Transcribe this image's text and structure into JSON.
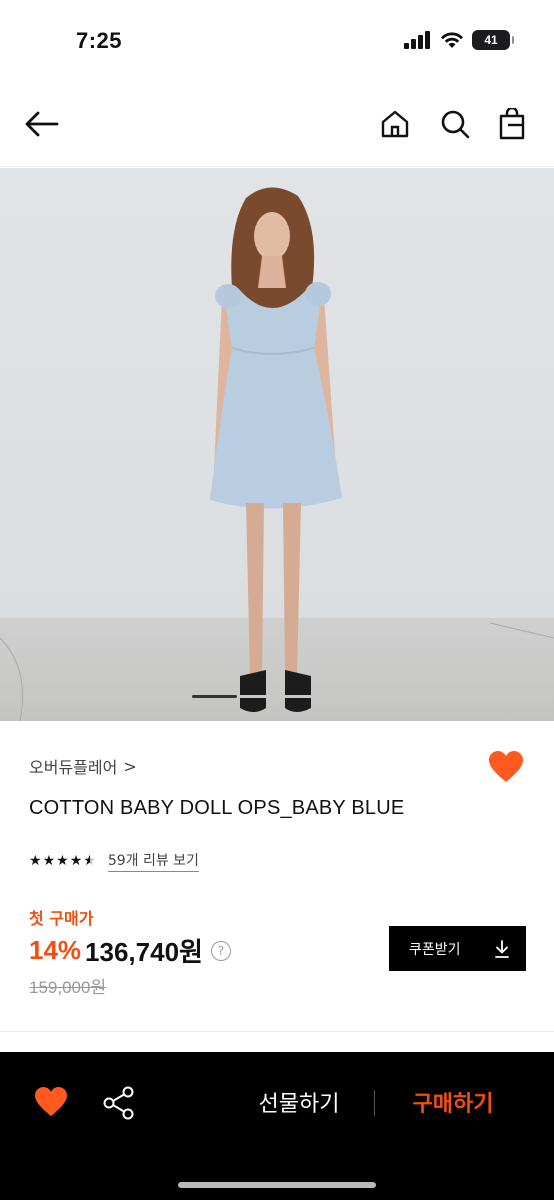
{
  "status_bar": {
    "time": "7:25",
    "battery": "41"
  },
  "header": {
    "icons": [
      "back-arrow-icon",
      "home-icon",
      "search-icon",
      "shopping-bag-icon"
    ]
  },
  "product": {
    "brand": "오버듀플레어",
    "brand_chevron": ">",
    "title": "COTTON BABY DOLL OPS_BABY BLUE",
    "rating": 4.5,
    "review_link": "59개 리뷰 보기",
    "price_label": "첫 구매가",
    "discount": "14%",
    "price": "136,740원",
    "original_price": "159,000원",
    "info_icon": "?",
    "image_count_position": "1"
  },
  "coupon_button": {
    "label": "쿠폰받기"
  },
  "bottom_bar": {
    "gift_label": "선물하기",
    "buy_label": "구매하기"
  },
  "colors": {
    "accent": "#f24f0e",
    "bar_bg": "#000000",
    "heart": "#ff5a1f"
  }
}
